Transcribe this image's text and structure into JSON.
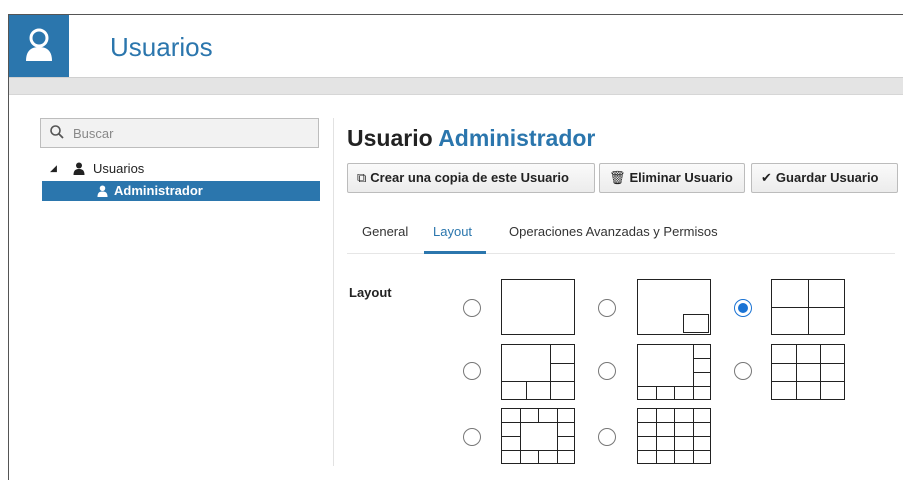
{
  "header": {
    "title": "Usuarios",
    "accent_color": "#2b76ad"
  },
  "sidebar": {
    "search_placeholder": "Buscar",
    "tree_root": "Usuarios",
    "tree_selected": "Administrador"
  },
  "main": {
    "title_prefix": "Usuario",
    "title_name": "Administrador",
    "buttons": {
      "copy": "Crear una copia de este Usuario",
      "delete": "Eliminar Usuario",
      "save": "Guardar Usuario"
    },
    "tabs": [
      "General",
      "Layout",
      "Operaciones Avanzadas y Permisos"
    ],
    "active_tab": "Layout",
    "layout_label": "Layout",
    "layout_options": [
      {
        "name": "layout-1x1",
        "selected": false
      },
      {
        "name": "layout-1-plus-pip",
        "selected": false
      },
      {
        "name": "layout-2x2",
        "selected": true
      },
      {
        "name": "layout-1-plus-5",
        "selected": false
      },
      {
        "name": "layout-1-plus-7",
        "selected": false
      },
      {
        "name": "layout-3x3",
        "selected": false
      },
      {
        "name": "layout-1-plus-12",
        "selected": false
      },
      {
        "name": "layout-4x4",
        "selected": false
      }
    ]
  },
  "icons": [
    "user-avatar-icon",
    "search-icon",
    "collapse-arrow-icon",
    "user-icon",
    "copy-icon",
    "trash-icon",
    "check-icon"
  ]
}
